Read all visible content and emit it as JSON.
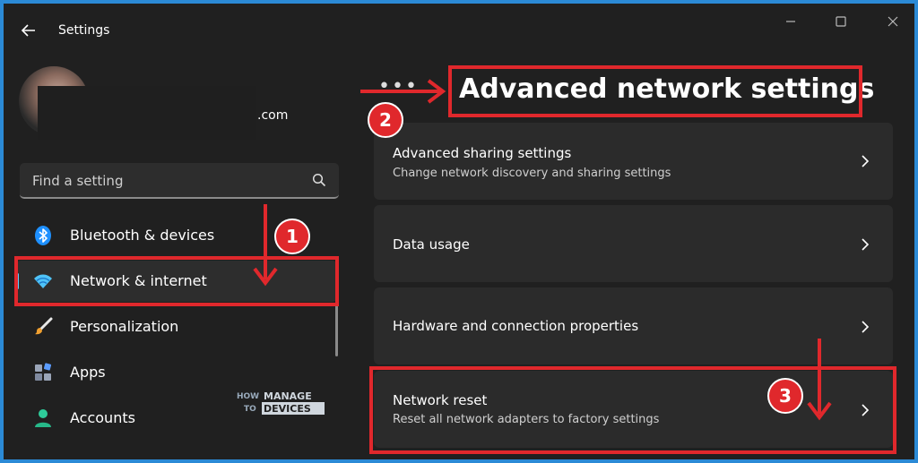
{
  "window": {
    "title": "Settings",
    "back_icon": "arrow-left-icon",
    "controls": [
      "minimize-icon",
      "maximize-icon",
      "close-icon"
    ]
  },
  "account": {
    "email_visible_suffix": ".com"
  },
  "search": {
    "placeholder": "Find a setting"
  },
  "sidebar": {
    "items": [
      {
        "label": "Bluetooth & devices",
        "icon": "bluetooth-icon",
        "active": false
      },
      {
        "label": "Network & internet",
        "icon": "wifi-icon",
        "active": true
      },
      {
        "label": "Personalization",
        "icon": "paintbrush-icon",
        "active": false
      },
      {
        "label": "Apps",
        "icon": "apps-icon",
        "active": false
      },
      {
        "label": "Accounts",
        "icon": "person-icon",
        "active": false
      }
    ]
  },
  "content": {
    "breadcrumb_more": "•••",
    "title": "Advanced network settings",
    "cards": [
      {
        "title": "Advanced sharing settings",
        "subtitle": "Change network discovery and sharing settings"
      },
      {
        "title": "Data usage",
        "subtitle": ""
      },
      {
        "title": "Hardware and connection properties",
        "subtitle": ""
      },
      {
        "title": "Network reset",
        "subtitle": "Reset all network adapters to factory settings"
      }
    ]
  },
  "annotations": {
    "step1": "1",
    "step2": "2",
    "step3": "3",
    "color": "#e0282c"
  },
  "watermark": {
    "line1": "HOW",
    "line2": "TO",
    "word1": "MANAGE",
    "word2": "DEVICES"
  },
  "colors": {
    "background": "#202020",
    "card": "#2b2b2b",
    "accent": "#60cdff"
  }
}
